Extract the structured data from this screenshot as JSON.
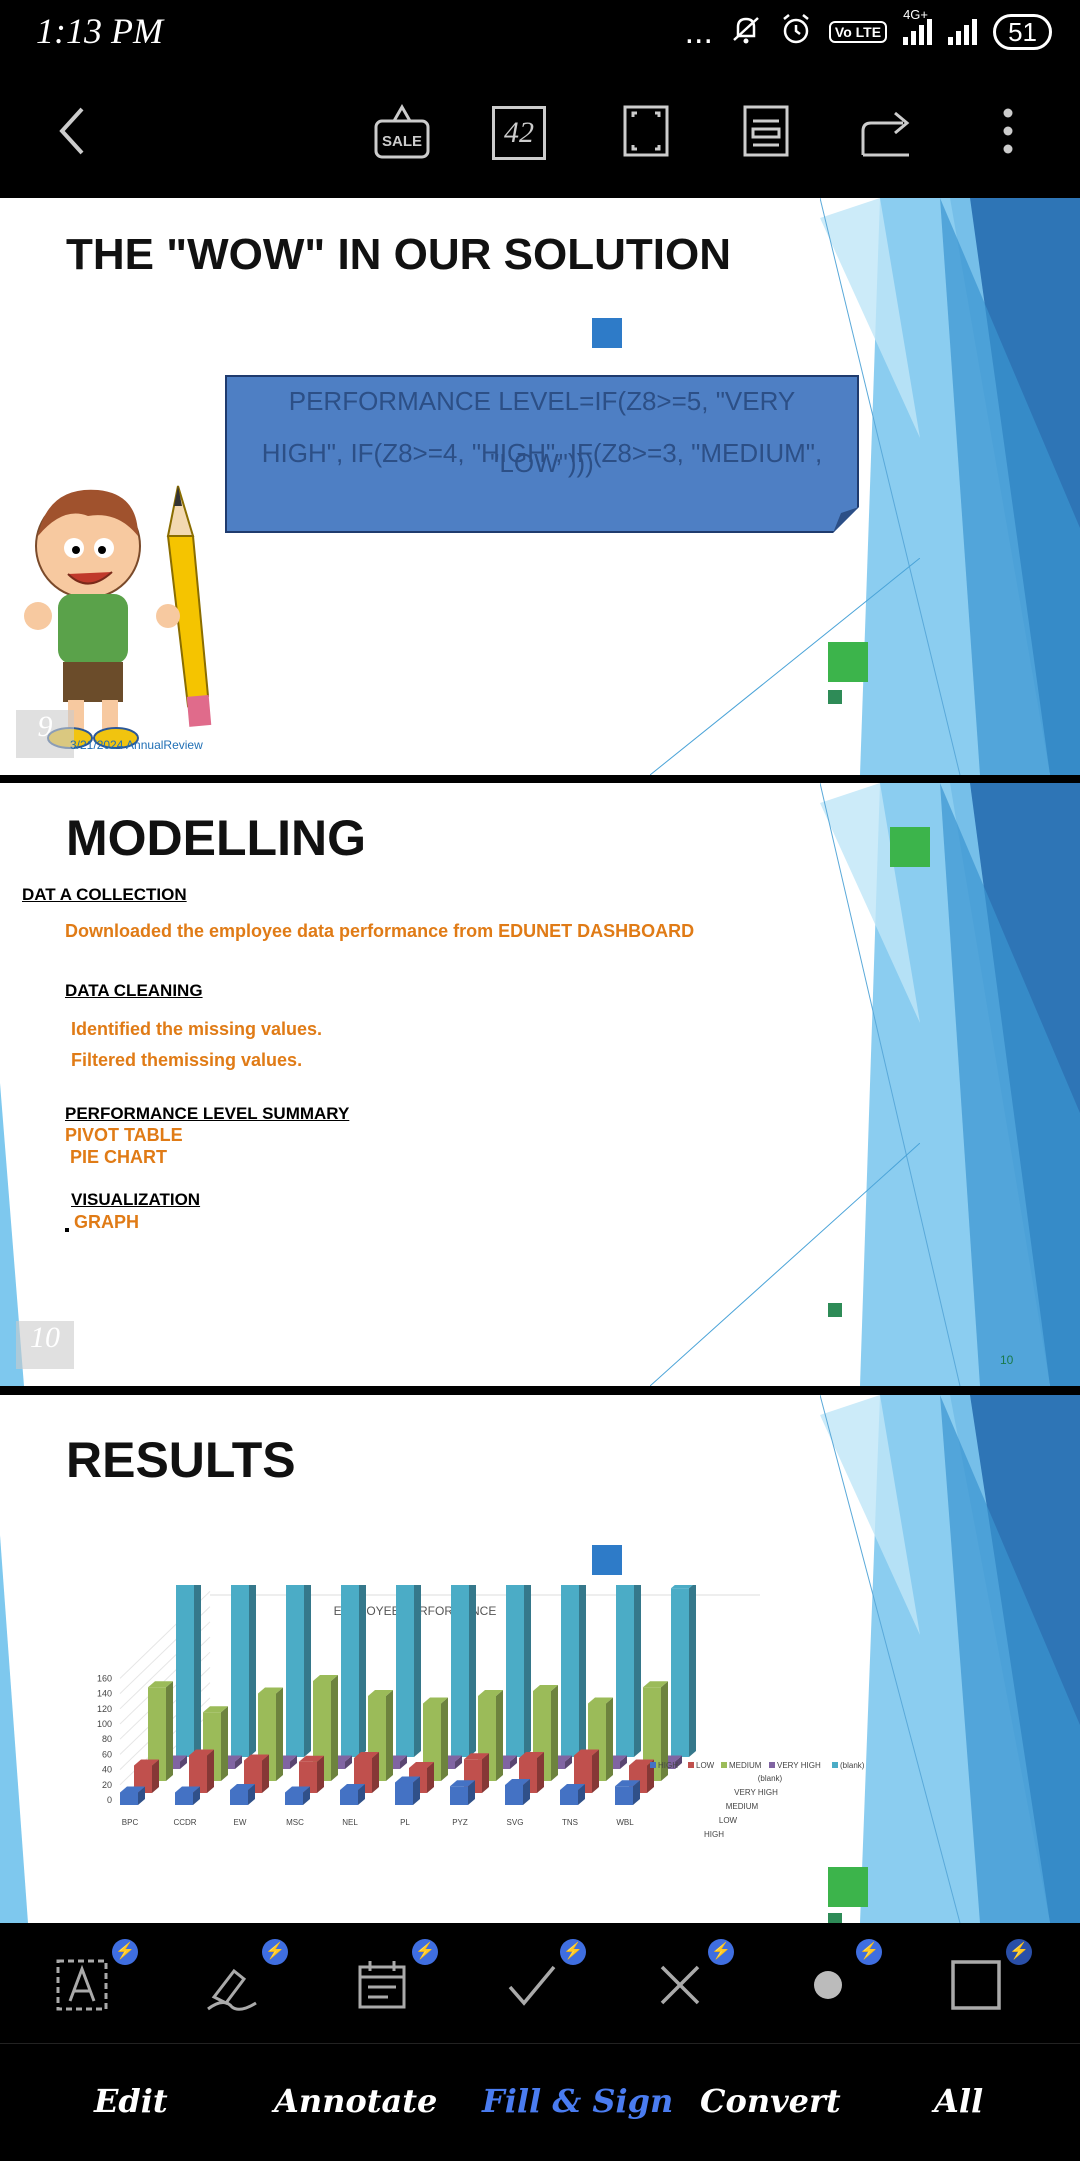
{
  "status": {
    "time": "1:13 PM",
    "network": "4G+",
    "volte": "Vo LTE",
    "battery": "51",
    "dots": "..."
  },
  "toolbar": {
    "page_number": "42",
    "sale_label": "SALE"
  },
  "slide1": {
    "title": "THE \"WOW\" IN OUR SOLUTION",
    "formula_line1": "PERFORMANCE LEVEL=IF(Z8>=5, \"VERY",
    "formula_line2": "HIGH\", IF(Z8>=4, \"HIGH\", IF(Z8>=3, \"MEDIUM\",",
    "formula_line3": "\"LOW\")))",
    "footer": "3/21/2024 AnnualReview",
    "page_badge": "9"
  },
  "slide2": {
    "title": "MODELLING",
    "section1_heading": "DAT A COLLECTION",
    "section1_text": "Downloaded the employee data performance from EDUNET DASHBOARD",
    "section2_heading": "DATA CLEANING",
    "section2_item1": "Identified the missing values.",
    "section2_item2": "Filtered themissing values.",
    "section3_heading": "PERFORMANCE LEVEL SUMMARY",
    "section3_item1": "PIVOT TABLE",
    "section3_item2": "PIE CHART",
    "section4_heading": "VISUALIZATION",
    "section4_item1": "GRAPH",
    "page_badge": "10",
    "page_number_small": "10"
  },
  "slide3": {
    "title": "RESULTS"
  },
  "chart_data": {
    "type": "bar",
    "title": "EMPLOYEE PERFORMANCE",
    "categories": [
      "BPC",
      "CCDR",
      "EW",
      "MSC",
      "NEL",
      "PL",
      "PYZ",
      "SVG",
      "TNS",
      "WBL"
    ],
    "yticks": [
      "0",
      "20",
      "40",
      "60",
      "80",
      "100",
      "120",
      "140",
      "160"
    ],
    "ylim": [
      0,
      160
    ],
    "series": [
      {
        "name": "HIGH",
        "color": "#4472c4",
        "values": [
          10,
          10,
          12,
          10,
          12,
          18,
          15,
          16,
          12,
          15
        ]
      },
      {
        "name": "LOW",
        "color": "#c0504d",
        "values": [
          22,
          30,
          26,
          25,
          28,
          20,
          27,
          28,
          30,
          22
        ]
      },
      {
        "name": "MEDIUM",
        "color": "#9bbb59",
        "values": [
          75,
          55,
          70,
          80,
          68,
          62,
          68,
          72,
          62,
          75
        ]
      },
      {
        "name": "VERY HIGH",
        "color": "#8064a2",
        "values": [
          6,
          6,
          6,
          6,
          6,
          6,
          6,
          6,
          6,
          6
        ]
      },
      {
        "name": "(blank)",
        "color": "#4bacc6",
        "values": [
          145,
          148,
          145,
          138,
          148,
          152,
          140,
          138,
          142,
          135
        ]
      }
    ],
    "depth_labels": [
      "(blank)",
      "VERY HIGH",
      "MEDIUM",
      "LOW",
      "HIGH"
    ],
    "legend_position": "right"
  },
  "signbar": {
    "items": [
      "text-box-icon",
      "signature-icon",
      "date-icon",
      "checkmark-icon",
      "cross-icon",
      "dot-icon",
      "rectangle-icon"
    ],
    "bolt": "⚡"
  },
  "tabs": {
    "edit": "Edit",
    "annotate": "Annotate",
    "fill_sign": "Fill & Sign",
    "convert": "Convert",
    "all": "All",
    "active_color": "#4a7cf0"
  }
}
